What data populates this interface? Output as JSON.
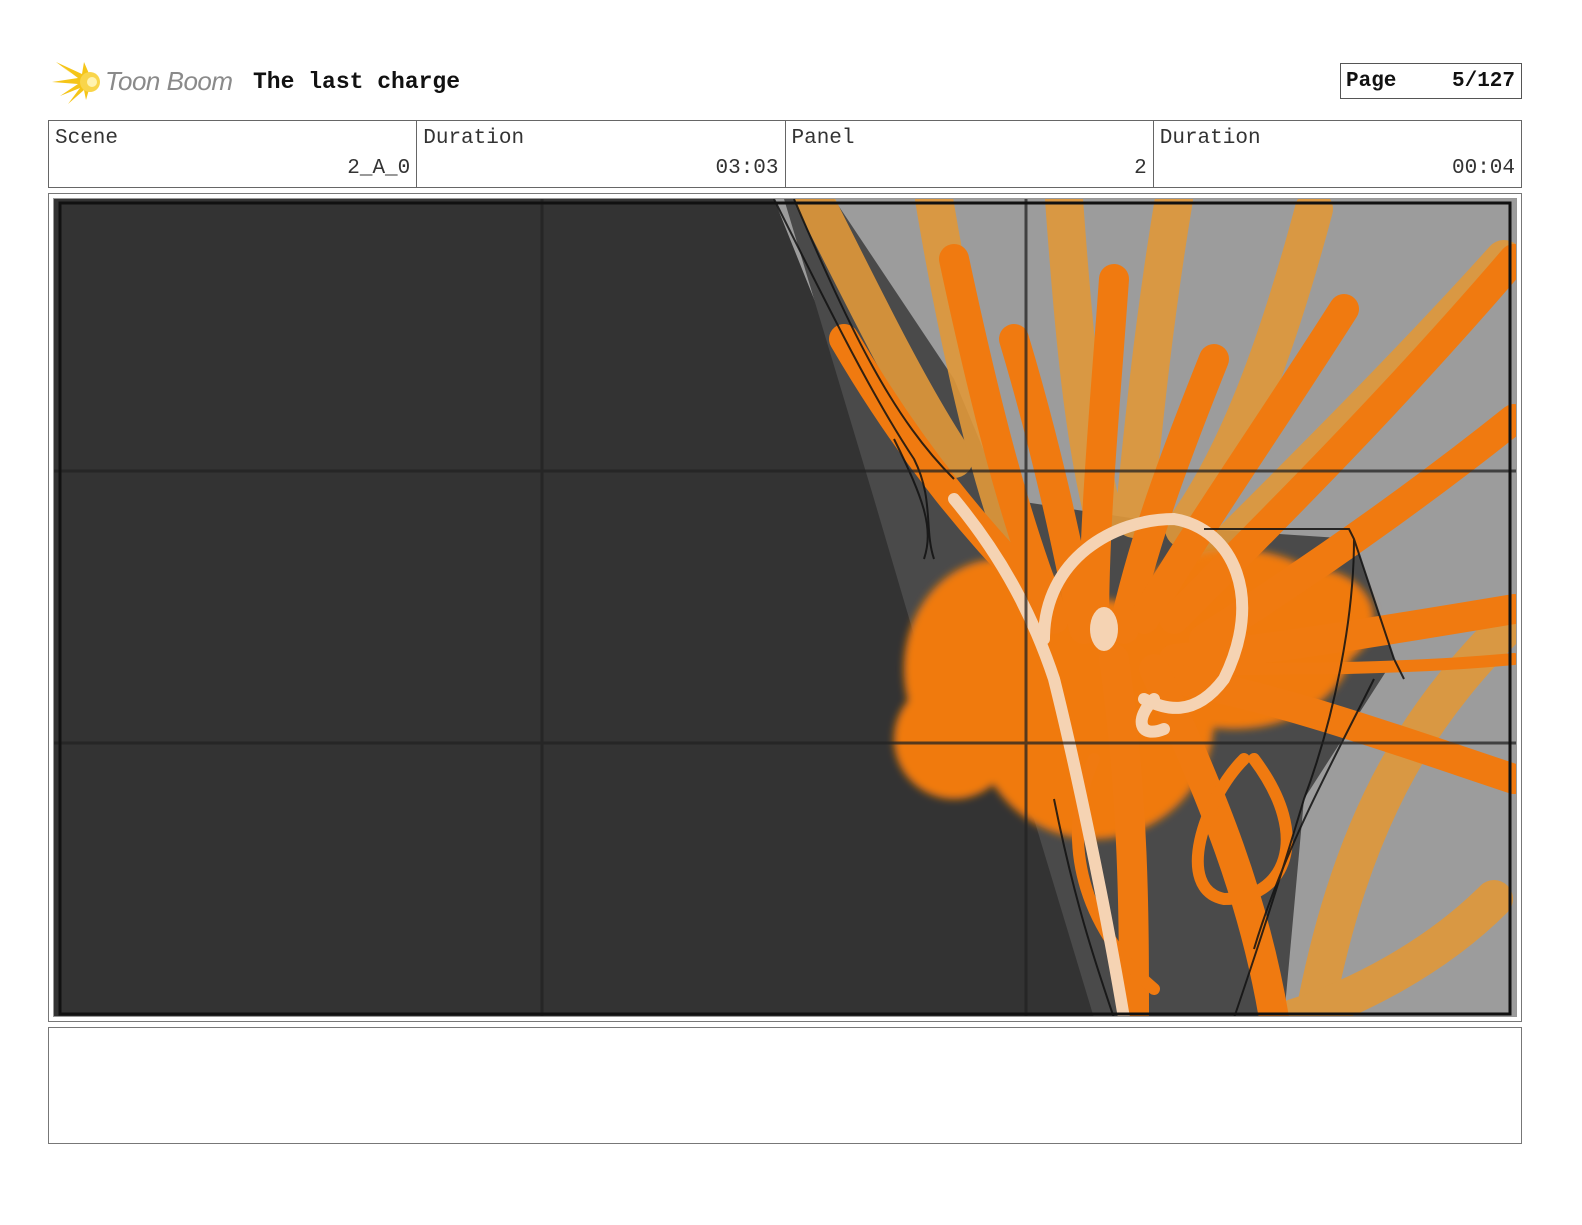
{
  "header": {
    "logo_text": "Toon Boom",
    "project_title": "The last charge",
    "page_label": "Page",
    "page_value": "5/127"
  },
  "info": {
    "scene_label": "Scene",
    "scene_value": "2_A_0",
    "scene_duration_label": "Duration",
    "scene_duration_value": "03:03",
    "panel_label": "Panel",
    "panel_value": "2",
    "panel_duration_label": "Duration",
    "panel_duration_value": "00:04"
  },
  "colors": {
    "logo_yellow": "#f5c518",
    "panel_dark": "#333333",
    "explosion_orange": "#f07a10",
    "explosion_light_orange": "#e0983a",
    "rock_gray": "#9c9c9c",
    "highlight_cream": "#f5d3b3"
  },
  "notes": {
    "text": ""
  }
}
